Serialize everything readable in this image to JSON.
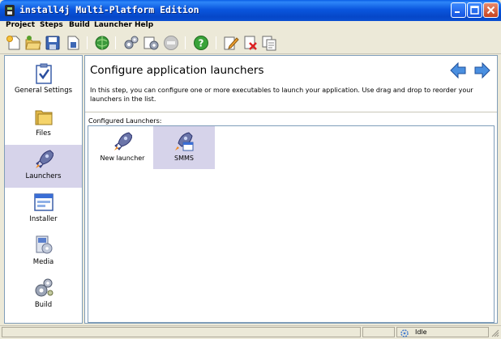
{
  "window": {
    "title": "install4j Multi-Platform Edition",
    "icons": {
      "app": "install4j-icon",
      "minimize": "minimize-icon",
      "maximize": "maximize-icon",
      "close": "close-icon"
    }
  },
  "menu": [
    {
      "label": "Project"
    },
    {
      "label": "Steps"
    },
    {
      "label": "Build"
    },
    {
      "label": "Launcher"
    },
    {
      "label": "Help"
    }
  ],
  "toolbar": [
    {
      "icon": "new-project-icon"
    },
    {
      "icon": "open-project-icon"
    },
    {
      "icon": "save-icon"
    },
    {
      "icon": "save-as-icon"
    },
    {
      "icon": "globe-icon"
    },
    {
      "icon": "build-gears-icon"
    },
    {
      "icon": "build-options-icon"
    },
    {
      "icon": "stop-icon"
    },
    {
      "icon": "help-icon"
    },
    {
      "icon": "edit-icon"
    },
    {
      "icon": "delete-icon"
    },
    {
      "icon": "copy-icon"
    }
  ],
  "sidebar": {
    "items": [
      {
        "label": "General Settings",
        "icon": "checklist-icon",
        "selected": false
      },
      {
        "label": "Files",
        "icon": "folder-icon",
        "selected": false
      },
      {
        "label": "Launchers",
        "icon": "rocket-icon",
        "selected": true
      },
      {
        "label": "Installer",
        "icon": "installer-window-icon",
        "selected": false
      },
      {
        "label": "Media",
        "icon": "media-icon",
        "selected": false
      },
      {
        "label": "Build",
        "icon": "build-icon",
        "selected": false
      }
    ]
  },
  "main": {
    "heading": "Configure application launchers",
    "description": "In this step, you can configure one or more executables to launch your application. Use drag and drop to reorder your launchers in the list.",
    "list_label": "Configured Launchers:",
    "nav": {
      "back_icon": "back-arrow-icon",
      "forward_icon": "forward-arrow-icon"
    },
    "launchers": [
      {
        "label": "New launcher",
        "icon": "rocket-icon",
        "selected": false
      },
      {
        "label": "SMMS",
        "icon": "rocket-window-icon",
        "selected": true
      }
    ]
  },
  "status": {
    "text": "Idle",
    "icon": "gear-spinner-icon"
  },
  "colors": {
    "titlebar": "#0A56DE",
    "selection": "#D6D3EA",
    "window_bg": "#ECE9D8",
    "panel_border": "#7F9DB9"
  }
}
